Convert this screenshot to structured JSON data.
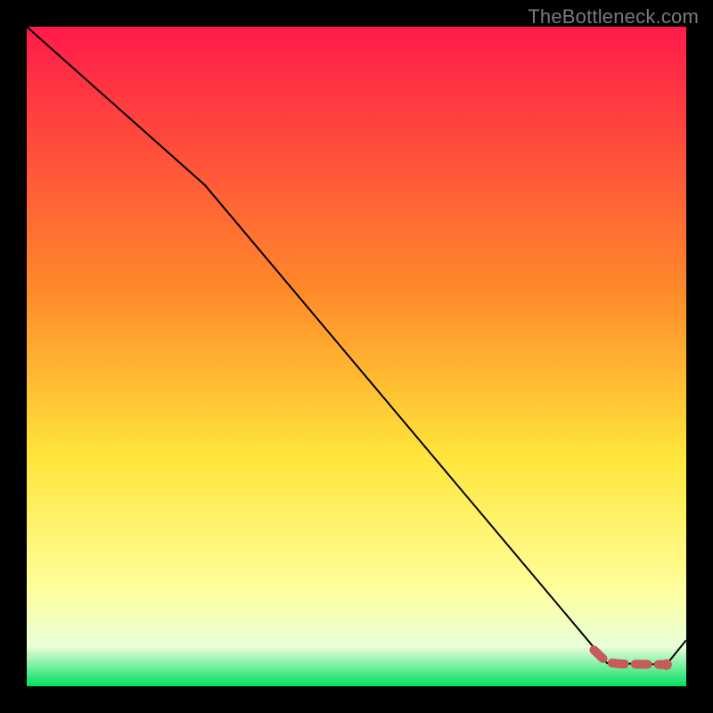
{
  "watermark": "TheBottleneck.com",
  "colors": {
    "frame_border": "#000000",
    "line_stroke": "#000000",
    "marker_stroke": "#c75a5a",
    "marker_fill": "#c75a5a",
    "gradient_top": "#ff1a4a",
    "gradient_mid_upper": "#ff8a2a",
    "gradient_mid": "#ffe53a",
    "gradient_mid_lower": "#ffff9a",
    "gradient_band": "#eaffda",
    "gradient_bottom": "#00e060"
  },
  "chart_data": {
    "type": "line",
    "title": "",
    "xlabel": "",
    "ylabel": "",
    "xlim": [
      0,
      100
    ],
    "ylim": [
      0,
      100
    ],
    "grid": false,
    "series": [
      {
        "name": "bottleneck-curve",
        "x": [
          0,
          27,
          88,
          97,
          100
        ],
        "y": [
          100,
          76,
          3.5,
          3.3,
          7
        ]
      }
    ],
    "highlighted_segment": {
      "name": "optimal-range",
      "style": "thick-dashed-marker",
      "x": [
        86,
        88,
        90,
        92,
        94,
        96,
        97
      ],
      "y": [
        5.5,
        3.6,
        3.4,
        3.35,
        3.32,
        3.3,
        3.3
      ]
    }
  }
}
